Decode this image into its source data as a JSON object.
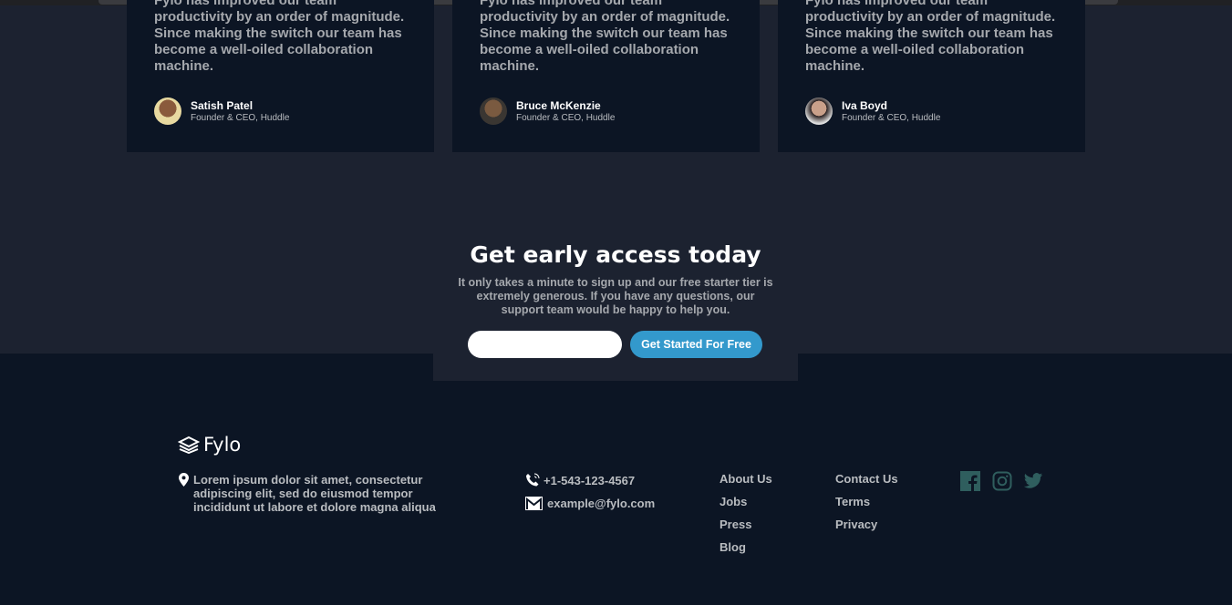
{
  "testimonials": [
    {
      "quote": "Fylo has improved our team productivity by an order of magnitude. Since making the switch our team has become a well-oiled collaboration machine.",
      "name": "Satish Patel",
      "role": "Founder & CEO, Huddle"
    },
    {
      "quote": "Fylo has improved our team productivity by an order of magnitude. Since making the switch our team has become a well-oiled collaboration machine.",
      "name": "Bruce McKenzie",
      "role": "Founder & CEO, Huddle"
    },
    {
      "quote": "Fylo has improved our team productivity by an order of magnitude. Since making the switch our team has become a well-oiled collaboration machine.",
      "name": "Iva Boyd",
      "role": "Founder & CEO, Huddle"
    }
  ],
  "cta": {
    "title": "Get early access today",
    "text": "It only takes a minute to sign up and our free starter tier is extremely generous. If you have any questions, our support team would be happy to help you.",
    "email_value": "",
    "button": "Get Started For Free"
  },
  "footer": {
    "logo": "Fylo",
    "address": "Lorem ipsum dolor sit amet, consectetur adipiscing elit, sed do eiusmod tempor incididunt ut labore et dolore magna aliqua",
    "phone": "+1-543-123-4567",
    "email": "example@fylo.com",
    "links1": [
      "About Us",
      "Jobs",
      "Press",
      "Blog"
    ],
    "links2": [
      "Contact Us",
      "Terms",
      "Privacy"
    ],
    "social": [
      "facebook-icon",
      "instagram-icon",
      "twitter-icon"
    ]
  },
  "colors": {
    "accent": "#3399cc",
    "footer_bg": "#0c1524",
    "section_bg": "#1c2230",
    "social": "#2f5e5e"
  }
}
